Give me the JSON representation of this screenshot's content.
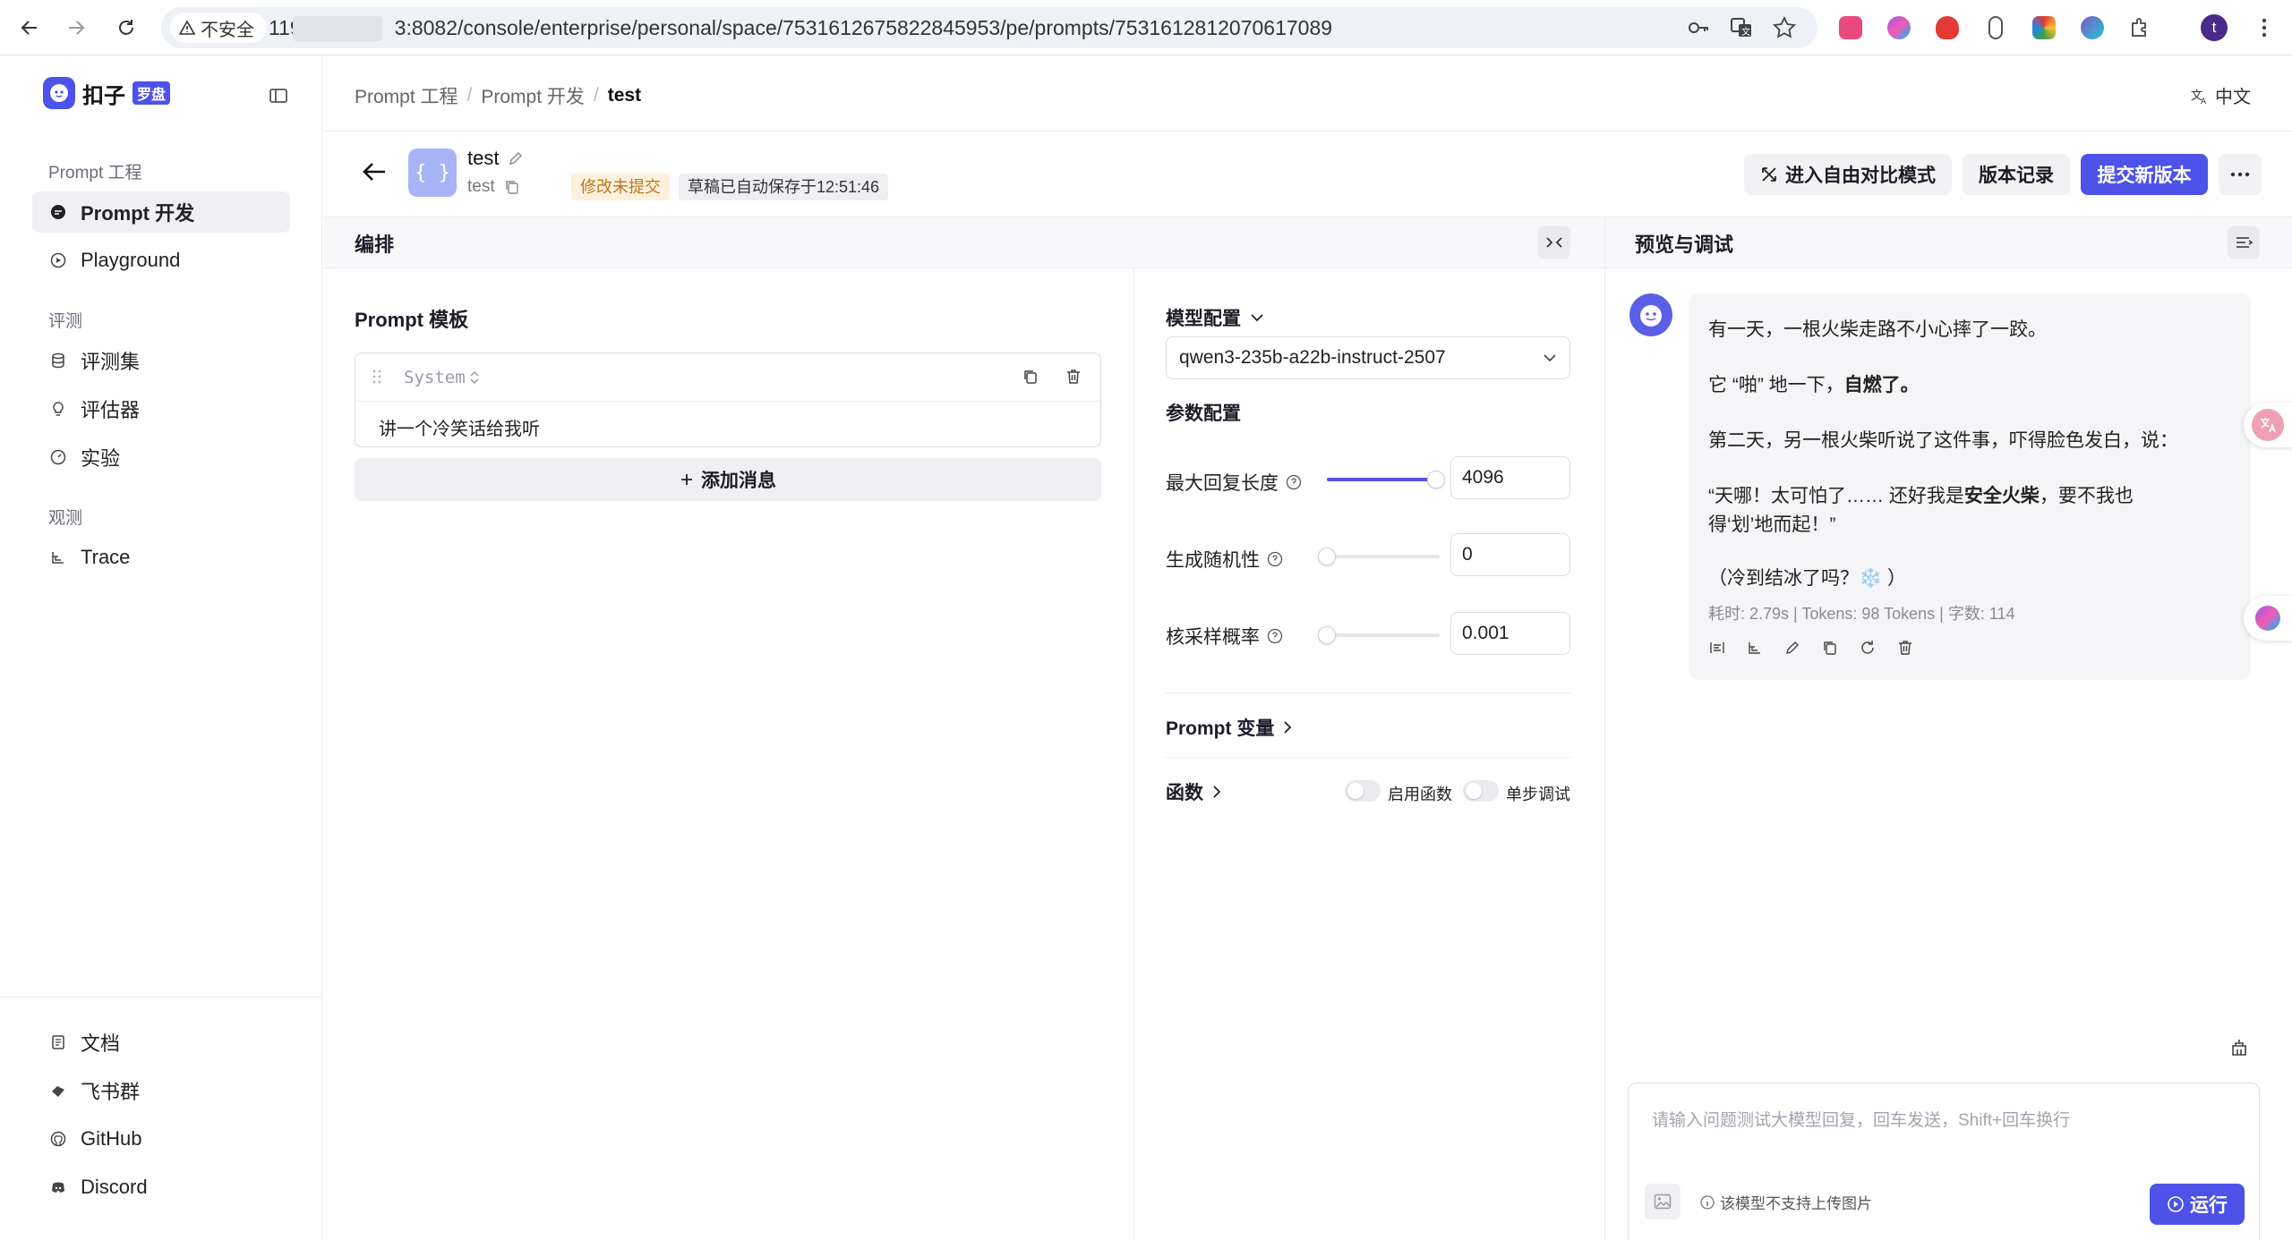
{
  "browser": {
    "security_label": "不安全",
    "url_prefix": "119",
    "url_rest": "3:8082/console/enterprise/personal/space/7531612675822845953/pe/prompts/7531612812070617089",
    "profile_initial": "t"
  },
  "brand": {
    "name": "扣子",
    "badge": "罗盘",
    "accent": "#4d53e8"
  },
  "sidebar": {
    "sections": [
      {
        "title": "Prompt 工程",
        "items": [
          {
            "label": "Prompt 开发",
            "icon": "chat-bubble-icon",
            "active": true
          },
          {
            "label": "Playground",
            "icon": "play-circle-icon",
            "active": false
          }
        ]
      },
      {
        "title": "评测",
        "items": [
          {
            "label": "评测集",
            "icon": "database-icon",
            "active": false
          },
          {
            "label": "评估器",
            "icon": "bulb-icon",
            "active": false
          },
          {
            "label": "实验",
            "icon": "gauge-icon",
            "active": false
          }
        ]
      },
      {
        "title": "观测",
        "items": [
          {
            "label": "Trace",
            "icon": "trace-icon",
            "active": false
          }
        ]
      }
    ],
    "bottom": [
      {
        "label": "文档",
        "icon": "doc-icon"
      },
      {
        "label": "飞书群",
        "icon": "feishu-icon"
      },
      {
        "label": "GitHub",
        "icon": "github-icon"
      },
      {
        "label": "Discord",
        "icon": "discord-icon"
      }
    ]
  },
  "breadcrumb": [
    "Prompt 工程",
    "Prompt 开发",
    "test"
  ],
  "language": "中文",
  "prompt": {
    "name": "test",
    "key": "test",
    "status_uncommitted": "修改未提交",
    "status_saved": "草稿已自动保存于12:51:46"
  },
  "header_buttons": {
    "compare": "进入自由对比模式",
    "versions": "版本记录",
    "submit": "提交新版本"
  },
  "panels": {
    "left_title": "编排",
    "right_title": "预览与调试"
  },
  "template": {
    "title": "Prompt 模板",
    "message_role": "System",
    "message_content": "讲一个冷笑话给我听",
    "add_message": "添加消息"
  },
  "model_config": {
    "title": "模型配置",
    "model": "qwen3-235b-a22b-instruct-2507",
    "params_title": "参数配置",
    "params": [
      {
        "label": "最大回复长度",
        "value": "4096",
        "fraction": 0.97
      },
      {
        "label": "生成随机性",
        "value": "0",
        "fraction": 0.0
      },
      {
        "label": "核采样概率",
        "value": "0.001",
        "fraction": 0.0
      }
    ],
    "variables_title": "Prompt 变量",
    "functions_title": "函数",
    "enable_functions": "启用函数",
    "step_debug": "单步调试"
  },
  "chat": {
    "response_lines": [
      {
        "text": "有一天，一根火柴走路不小心摔了一跤。"
      },
      {
        "text": "它 “啪” 地一下，",
        "bold": "自燃了。"
      },
      {
        "text": "第二天，另一根火柴听说了这件事，吓得脸色发白，说："
      },
      {
        "text": "“天哪！太可怕了…… 还好我是",
        "bold": "安全火柴",
        "tail": "，要不我也"
      },
      {
        "text": "得‘划’地而起！”"
      },
      {
        "text": "（冷到结冰了吗？❄️ ）"
      }
    ],
    "stats": "耗时: 2.79s | Tokens: 98 Tokens | 字数: 114",
    "input_placeholder": "请输入问题测试大模型回复，回车发送，Shift+回车换行",
    "no_image_note": "该模型不支持上传图片",
    "run_label": "运行"
  }
}
